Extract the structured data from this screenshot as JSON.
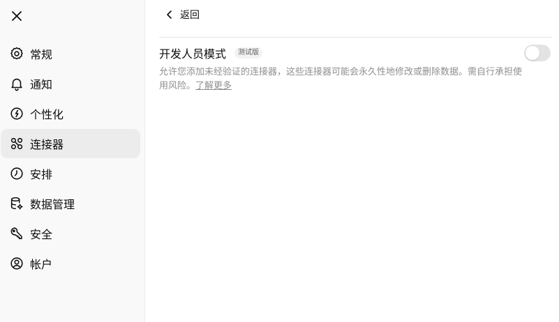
{
  "sidebar": {
    "items": [
      {
        "label": "常规",
        "icon": "gear-icon",
        "active": false
      },
      {
        "label": "通知",
        "icon": "bell-icon",
        "active": false
      },
      {
        "label": "个性化",
        "icon": "personalize-icon",
        "active": false
      },
      {
        "label": "连接器",
        "icon": "connector-icon",
        "active": true
      },
      {
        "label": "安排",
        "icon": "clock-icon",
        "active": false
      },
      {
        "label": "数据管理",
        "icon": "database-gear-icon",
        "active": false
      },
      {
        "label": "安全",
        "icon": "key-icon",
        "active": false
      },
      {
        "label": "帐户",
        "icon": "user-circle-icon",
        "active": false
      }
    ]
  },
  "main": {
    "back_label": "返回",
    "setting": {
      "title": "开发人员模式",
      "badge": "测试版",
      "description": "允许您添加未经验证的连接器，这些连接器可能会永久性地修改或删除数据。需自行承担使用风险。",
      "learn_more": "了解更多",
      "enabled": false
    }
  },
  "colors": {
    "sidebar_bg": "#f9f9f9",
    "active_item_bg": "#ececec",
    "toggle_off": "#e3e3e3",
    "muted_text": "#8f8f8f"
  }
}
